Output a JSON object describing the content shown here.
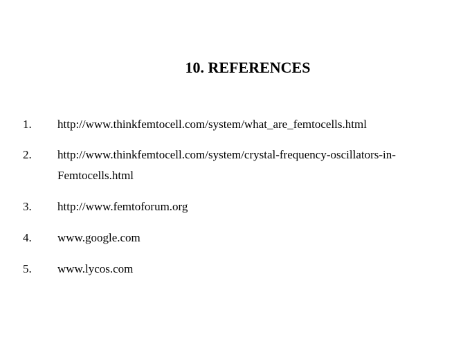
{
  "heading": "10. REFERENCES",
  "references": [
    {
      "number": "1.",
      "lines": [
        "http://www.thinkfemtocell.com/system/what_are_femtocells.html"
      ]
    },
    {
      "number": "2.",
      "lines": [
        "http://www.thinkfemtocell.com/system/crystal-frequency-oscillators-in-",
        "Femtocells.html"
      ]
    },
    {
      "number": "3.",
      "lines": [
        "http://www.femtoforum.org"
      ]
    },
    {
      "number": "4.",
      "lines": [
        "www.google.com"
      ]
    },
    {
      "number": "5.",
      "lines": [
        "www.lycos.com"
      ]
    }
  ]
}
